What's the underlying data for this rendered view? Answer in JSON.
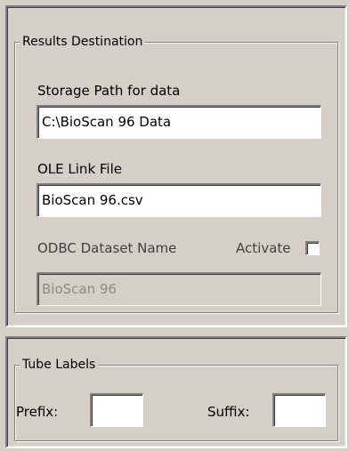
{
  "results_destination": {
    "title": "Results Destination",
    "storage_path_label": "Storage Path for data",
    "storage_path_value": "C:\\BioScan 96 Data",
    "ole_link_label": "OLE Link File",
    "ole_link_value": "BioScan 96.csv",
    "odbc_label": "ODBC Dataset Name",
    "activate_label": "Activate",
    "activate_checked": false,
    "odbc_value": "BioScan 96"
  },
  "tube_labels": {
    "title": "Tube Labels",
    "prefix_label": "Prefix:",
    "prefix_value": "",
    "suffix_label": "Suffix:",
    "suffix_value": ""
  }
}
